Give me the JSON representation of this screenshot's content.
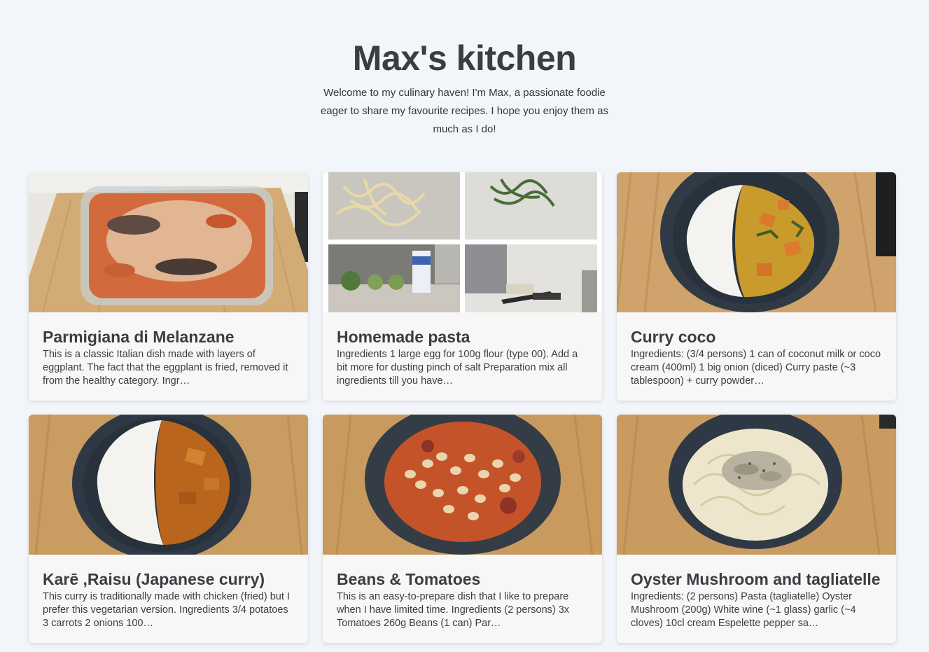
{
  "header": {
    "title": "Max's kitchen",
    "intro": "Welcome to my culinary haven! I'm Max, a passionate foodie eager to share my favourite recipes. I hope you enjoy them as much as I do!"
  },
  "recipes": [
    {
      "title": "Parmigiana di Melanzane",
      "description": "This is a classic Italian dish made with layers of eggplant. The fact that the eggplant is fried, removed it from the healthy category. Ingr…",
      "photo_icon": "baking-dish-photo"
    },
    {
      "title": "Homemade pasta",
      "description": "Ingredients 1 large egg for 100g flour (type 00). Add a bit more for dusting pinch of salt Preparation mix all ingredients till you have…",
      "photo_icon": "pasta-collage-photo"
    },
    {
      "title": "Curry coco",
      "description": "Ingredients: (3/4 persons) 1 can of coconut milk or coco cream (400ml) 1 big onion (diced) Curry paste (~3 tablespoon) + curry powder…",
      "photo_icon": "curry-bowl-photo"
    },
    {
      "title": "Karē ,Raisu (Japanese curry)",
      "description": "This curry is traditionally made with chicken (fried) but I prefer this vegetarian version. Ingredients 3/4 potatoes 3 carrots 2 onions 100…",
      "photo_icon": "japanese-curry-photo"
    },
    {
      "title": "Beans & Tomatoes",
      "description": "This is an easy-to-prepare dish that I like to prepare when I have limited time. Ingredients (2 persons) 3x Tomatoes 260g Beans (1 can) Par…",
      "photo_icon": "beans-bowl-photo"
    },
    {
      "title": "Oyster Mushroom and tagliatelle",
      "description": "Ingredients: (2 persons) Pasta (tagliatelle) Oyster Mushroom (200g) White wine (~1 glass) garlic (~4 cloves) 10cl cream Espelette pepper sa…",
      "photo_icon": "mushroom-pasta-photo"
    }
  ],
  "colors": {
    "background": "#f2f5f9",
    "card": "#f7f7f7",
    "text": "#3a3d42"
  }
}
